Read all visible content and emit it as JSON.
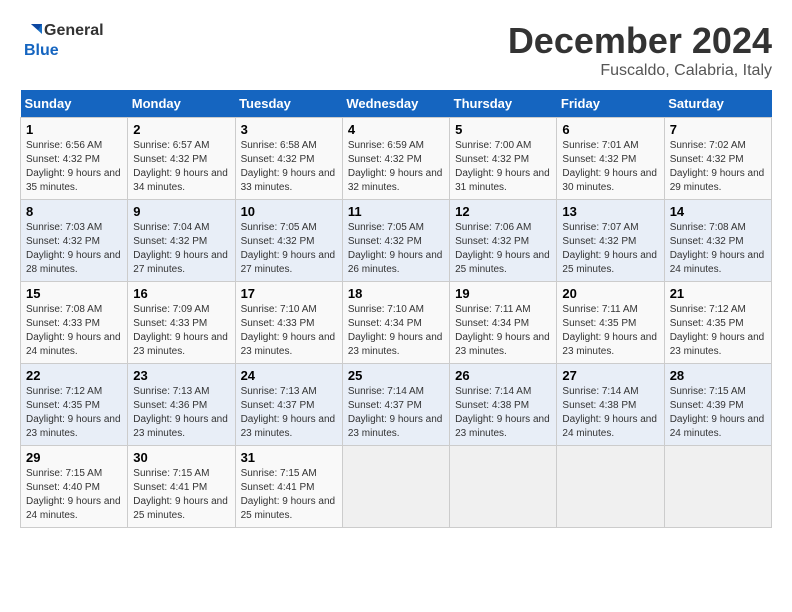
{
  "header": {
    "logo_line1": "General",
    "logo_line2": "Blue",
    "month": "December 2024",
    "location": "Fuscaldo, Calabria, Italy"
  },
  "days_of_week": [
    "Sunday",
    "Monday",
    "Tuesday",
    "Wednesday",
    "Thursday",
    "Friday",
    "Saturday"
  ],
  "weeks": [
    [
      {
        "day": "1",
        "sunrise": "6:56 AM",
        "sunset": "4:32 PM",
        "daylight": "9 hours and 35 minutes."
      },
      {
        "day": "2",
        "sunrise": "6:57 AM",
        "sunset": "4:32 PM",
        "daylight": "9 hours and 34 minutes."
      },
      {
        "day": "3",
        "sunrise": "6:58 AM",
        "sunset": "4:32 PM",
        "daylight": "9 hours and 33 minutes."
      },
      {
        "day": "4",
        "sunrise": "6:59 AM",
        "sunset": "4:32 PM",
        "daylight": "9 hours and 32 minutes."
      },
      {
        "day": "5",
        "sunrise": "7:00 AM",
        "sunset": "4:32 PM",
        "daylight": "9 hours and 31 minutes."
      },
      {
        "day": "6",
        "sunrise": "7:01 AM",
        "sunset": "4:32 PM",
        "daylight": "9 hours and 30 minutes."
      },
      {
        "day": "7",
        "sunrise": "7:02 AM",
        "sunset": "4:32 PM",
        "daylight": "9 hours and 29 minutes."
      }
    ],
    [
      {
        "day": "8",
        "sunrise": "7:03 AM",
        "sunset": "4:32 PM",
        "daylight": "9 hours and 28 minutes."
      },
      {
        "day": "9",
        "sunrise": "7:04 AM",
        "sunset": "4:32 PM",
        "daylight": "9 hours and 27 minutes."
      },
      {
        "day": "10",
        "sunrise": "7:05 AM",
        "sunset": "4:32 PM",
        "daylight": "9 hours and 27 minutes."
      },
      {
        "day": "11",
        "sunrise": "7:05 AM",
        "sunset": "4:32 PM",
        "daylight": "9 hours and 26 minutes."
      },
      {
        "day": "12",
        "sunrise": "7:06 AM",
        "sunset": "4:32 PM",
        "daylight": "9 hours and 25 minutes."
      },
      {
        "day": "13",
        "sunrise": "7:07 AM",
        "sunset": "4:32 PM",
        "daylight": "9 hours and 25 minutes."
      },
      {
        "day": "14",
        "sunrise": "7:08 AM",
        "sunset": "4:32 PM",
        "daylight": "9 hours and 24 minutes."
      }
    ],
    [
      {
        "day": "15",
        "sunrise": "7:08 AM",
        "sunset": "4:33 PM",
        "daylight": "9 hours and 24 minutes."
      },
      {
        "day": "16",
        "sunrise": "7:09 AM",
        "sunset": "4:33 PM",
        "daylight": "9 hours and 23 minutes."
      },
      {
        "day": "17",
        "sunrise": "7:10 AM",
        "sunset": "4:33 PM",
        "daylight": "9 hours and 23 minutes."
      },
      {
        "day": "18",
        "sunrise": "7:10 AM",
        "sunset": "4:34 PM",
        "daylight": "9 hours and 23 minutes."
      },
      {
        "day": "19",
        "sunrise": "7:11 AM",
        "sunset": "4:34 PM",
        "daylight": "9 hours and 23 minutes."
      },
      {
        "day": "20",
        "sunrise": "7:11 AM",
        "sunset": "4:35 PM",
        "daylight": "9 hours and 23 minutes."
      },
      {
        "day": "21",
        "sunrise": "7:12 AM",
        "sunset": "4:35 PM",
        "daylight": "9 hours and 23 minutes."
      }
    ],
    [
      {
        "day": "22",
        "sunrise": "7:12 AM",
        "sunset": "4:35 PM",
        "daylight": "9 hours and 23 minutes."
      },
      {
        "day": "23",
        "sunrise": "7:13 AM",
        "sunset": "4:36 PM",
        "daylight": "9 hours and 23 minutes."
      },
      {
        "day": "24",
        "sunrise": "7:13 AM",
        "sunset": "4:37 PM",
        "daylight": "9 hours and 23 minutes."
      },
      {
        "day": "25",
        "sunrise": "7:14 AM",
        "sunset": "4:37 PM",
        "daylight": "9 hours and 23 minutes."
      },
      {
        "day": "26",
        "sunrise": "7:14 AM",
        "sunset": "4:38 PM",
        "daylight": "9 hours and 23 minutes."
      },
      {
        "day": "27",
        "sunrise": "7:14 AM",
        "sunset": "4:38 PM",
        "daylight": "9 hours and 24 minutes."
      },
      {
        "day": "28",
        "sunrise": "7:15 AM",
        "sunset": "4:39 PM",
        "daylight": "9 hours and 24 minutes."
      }
    ],
    [
      {
        "day": "29",
        "sunrise": "7:15 AM",
        "sunset": "4:40 PM",
        "daylight": "9 hours and 24 minutes."
      },
      {
        "day": "30",
        "sunrise": "7:15 AM",
        "sunset": "4:41 PM",
        "daylight": "9 hours and 25 minutes."
      },
      {
        "day": "31",
        "sunrise": "7:15 AM",
        "sunset": "4:41 PM",
        "daylight": "9 hours and 25 minutes."
      },
      null,
      null,
      null,
      null
    ]
  ]
}
